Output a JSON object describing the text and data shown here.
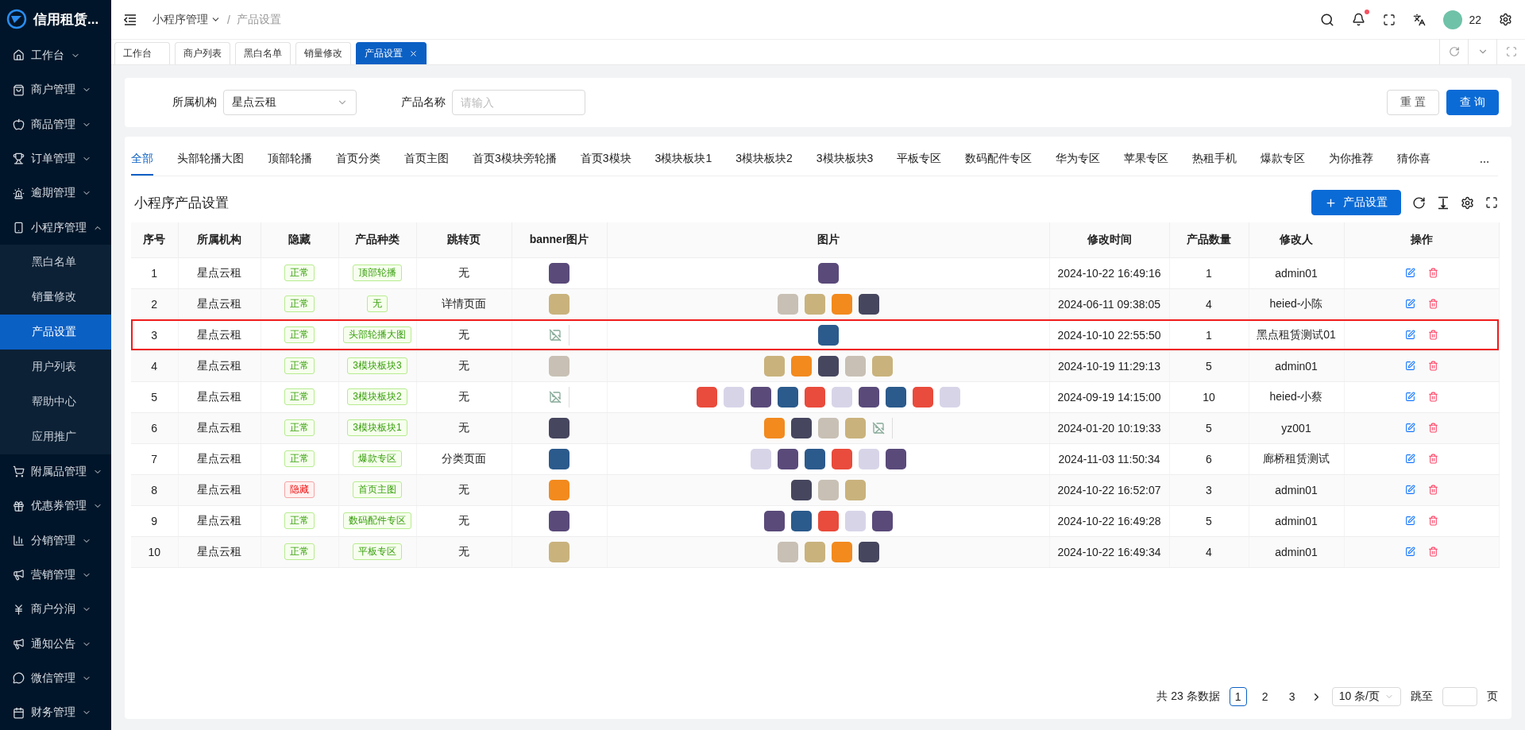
{
  "brand": {
    "title": "信用租赁..."
  },
  "sidebar": {
    "items": [
      {
        "label": "工作台",
        "expanded": false
      },
      {
        "label": "商户管理",
        "expanded": false
      },
      {
        "label": "商品管理",
        "expanded": false
      },
      {
        "label": "订单管理",
        "expanded": false
      },
      {
        "label": "逾期管理",
        "expanded": false
      },
      {
        "label": "小程序管理",
        "expanded": true,
        "children": [
          {
            "label": "黑白名单",
            "selected": false
          },
          {
            "label": "销量修改",
            "selected": false
          },
          {
            "label": "产品设置",
            "selected": true
          },
          {
            "label": "用户列表",
            "selected": false
          },
          {
            "label": "帮助中心",
            "selected": false
          },
          {
            "label": "应用推广",
            "selected": false
          }
        ]
      },
      {
        "label": "附属品管理",
        "expanded": false
      },
      {
        "label": "优惠券管理",
        "expanded": false
      },
      {
        "label": "分销管理",
        "expanded": false
      },
      {
        "label": "营销管理",
        "expanded": false
      },
      {
        "label": "商户分润",
        "expanded": false
      },
      {
        "label": "通知公告",
        "expanded": false
      },
      {
        "label": "微信管理",
        "expanded": false
      },
      {
        "label": "财务管理",
        "expanded": false
      }
    ]
  },
  "header": {
    "breadcrumb": [
      "小程序管理",
      "产品设置"
    ],
    "separator": "/",
    "user": "22",
    "has_notification": true
  },
  "page_tabs": [
    {
      "label": "工作台",
      "selected": false
    },
    {
      "label": "商户列表",
      "selected": false
    },
    {
      "label": "黑白名单",
      "selected": false
    },
    {
      "label": "销量修改",
      "selected": false
    },
    {
      "label": "产品设置",
      "selected": true
    }
  ],
  "filters": {
    "org_label": "所属机构",
    "org_value": "星点云租",
    "name_label": "产品名称",
    "name_placeholder": "请输入",
    "reset": "重 置",
    "query": "查 询"
  },
  "category_tabs": [
    {
      "label": "全部",
      "selected": true
    },
    {
      "label": "头部轮播大图",
      "selected": false
    },
    {
      "label": "顶部轮播",
      "selected": false
    },
    {
      "label": "首页分类",
      "selected": false
    },
    {
      "label": "首页主图",
      "selected": false
    },
    {
      "label": "首页3模块旁轮播",
      "selected": false
    },
    {
      "label": "首页3模块",
      "selected": false
    },
    {
      "label": "3模块板块1",
      "selected": false
    },
    {
      "label": "3模块板块2",
      "selected": false
    },
    {
      "label": "3模块板块3",
      "selected": false
    },
    {
      "label": "平板专区",
      "selected": false
    },
    {
      "label": "数码配件专区",
      "selected": false
    },
    {
      "label": "华为专区",
      "selected": false
    },
    {
      "label": "苹果专区",
      "selected": false
    },
    {
      "label": "热租手机",
      "selected": false
    },
    {
      "label": "爆款专区",
      "selected": false
    },
    {
      "label": "为你推荐",
      "selected": false
    },
    {
      "label": "猜你喜",
      "selected": false
    }
  ],
  "table": {
    "title": "小程序产品设置",
    "add_button": "产品设置",
    "columns": [
      "序号",
      "所属机构",
      "隐藏",
      "产品种类",
      "跳转页",
      "banner图片",
      "图片",
      "修改时间",
      "产品数量",
      "修改人",
      "操作"
    ],
    "rows": [
      {
        "index": "1",
        "org": "星点云租",
        "status": "正常",
        "hidden": false,
        "category": "顶部轮播",
        "target": "无",
        "banner": {
          "broken": false
        },
        "pictures": [
          {
            "broken": false
          }
        ],
        "modified": "2024-10-22 16:49:16",
        "count": "1",
        "editor": "admin01",
        "highlighted": false
      },
      {
        "index": "2",
        "org": "星点云租",
        "status": "正常",
        "hidden": false,
        "category": "无",
        "target": "详情页面",
        "banner": {
          "broken": false
        },
        "pictures": [
          {
            "broken": false
          },
          {
            "broken": false
          },
          {
            "broken": false
          },
          {
            "broken": false
          }
        ],
        "modified": "2024-06-11 09:38:05",
        "count": "4",
        "editor": "heied-小陈",
        "highlighted": false
      },
      {
        "index": "3",
        "org": "星点云租",
        "status": "正常",
        "hidden": false,
        "category": "头部轮播大图",
        "target": "无",
        "banner": {
          "broken": true
        },
        "pictures": [
          {
            "broken": false
          }
        ],
        "modified": "2024-10-10 22:55:50",
        "count": "1",
        "editor": "黑点租赁测试01",
        "highlighted": true
      },
      {
        "index": "4",
        "org": "星点云租",
        "status": "正常",
        "hidden": false,
        "category": "3模块板块3",
        "target": "无",
        "banner": {
          "broken": false
        },
        "pictures": [
          {
            "broken": false
          },
          {
            "broken": false
          },
          {
            "broken": false
          },
          {
            "broken": false
          },
          {
            "broken": false
          }
        ],
        "modified": "2024-10-19 11:29:13",
        "count": "5",
        "editor": "admin01",
        "highlighted": false
      },
      {
        "index": "5",
        "org": "星点云租",
        "status": "正常",
        "hidden": false,
        "category": "3模块板块2",
        "target": "无",
        "banner": {
          "broken": true
        },
        "pictures": [
          {
            "broken": false
          },
          {
            "broken": false
          },
          {
            "broken": false
          },
          {
            "broken": false
          },
          {
            "broken": false
          },
          {
            "broken": false
          },
          {
            "broken": false
          },
          {
            "broken": false
          },
          {
            "broken": false
          },
          {
            "broken": false
          }
        ],
        "modified": "2024-09-19 14:15:00",
        "count": "10",
        "editor": "heied-小蔡",
        "highlighted": false
      },
      {
        "index": "6",
        "org": "星点云租",
        "status": "正常",
        "hidden": false,
        "category": "3模块板块1",
        "target": "无",
        "banner": {
          "broken": false
        },
        "pictures": [
          {
            "broken": false
          },
          {
            "broken": false
          },
          {
            "broken": false
          },
          {
            "broken": false
          },
          {
            "broken": true
          }
        ],
        "modified": "2024-01-20 10:19:33",
        "count": "5",
        "editor": "yz001",
        "highlighted": false
      },
      {
        "index": "7",
        "org": "星点云租",
        "status": "正常",
        "hidden": false,
        "category": "爆款专区",
        "target": "分类页面",
        "banner": {
          "broken": false
        },
        "pictures": [
          {
            "broken": false
          },
          {
            "broken": false
          },
          {
            "broken": false
          },
          {
            "broken": false
          },
          {
            "broken": false
          },
          {
            "broken": false
          }
        ],
        "modified": "2024-11-03 11:50:34",
        "count": "6",
        "editor": "廊桥租赁测试",
        "highlighted": false
      },
      {
        "index": "8",
        "org": "星点云租",
        "status": "隐藏",
        "hidden": true,
        "category": "首页主图",
        "target": "无",
        "banner": {
          "broken": false
        },
        "pictures": [
          {
            "broken": false
          },
          {
            "broken": false
          },
          {
            "broken": false
          }
        ],
        "modified": "2024-10-22 16:52:07",
        "count": "3",
        "editor": "admin01",
        "highlighted": false
      },
      {
        "index": "9",
        "org": "星点云租",
        "status": "正常",
        "hidden": false,
        "category": "数码配件专区",
        "target": "无",
        "banner": {
          "broken": false
        },
        "pictures": [
          {
            "broken": false
          },
          {
            "broken": false
          },
          {
            "broken": false
          },
          {
            "broken": false
          },
          {
            "broken": false
          }
        ],
        "modified": "2024-10-22 16:49:28",
        "count": "5",
        "editor": "admin01",
        "highlighted": false
      },
      {
        "index": "10",
        "org": "星点云租",
        "status": "正常",
        "hidden": false,
        "category": "平板专区",
        "target": "无",
        "banner": {
          "broken": false
        },
        "pictures": [
          {
            "broken": false
          },
          {
            "broken": false
          },
          {
            "broken": false
          },
          {
            "broken": false
          }
        ],
        "modified": "2024-10-22 16:49:34",
        "count": "4",
        "editor": "admin01",
        "highlighted": false
      }
    ]
  },
  "pagination": {
    "total": "共 23 条数据",
    "pages": [
      {
        "label": "1",
        "selected": true
      },
      {
        "label": "2",
        "selected": false
      },
      {
        "label": "3",
        "selected": false
      }
    ],
    "page_size": "10 条/页",
    "jump_label": "跳至",
    "page_suffix": "页"
  }
}
